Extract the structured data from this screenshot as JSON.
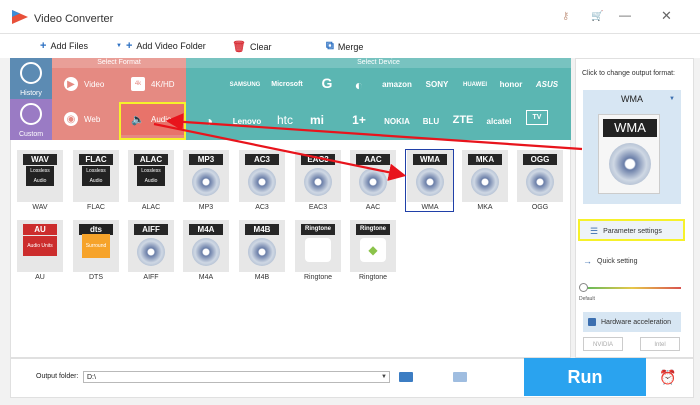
{
  "window": {
    "title": "Video Converter"
  },
  "toolbar": {
    "add_files": "Add Files",
    "add_video_folder": "Add Video Folder",
    "clear": "Clear",
    "merge": "Merge"
  },
  "sidebar": {
    "history": "History",
    "custom": "Custom"
  },
  "select_format": {
    "header": "Select Format",
    "items": [
      {
        "label": "Video"
      },
      {
        "label": "4K/HD"
      },
      {
        "label": "Web"
      },
      {
        "label": "Audio",
        "selected": true
      }
    ]
  },
  "select_device": {
    "header": "Select Device",
    "brands_row1": [
      "SAMSUNG",
      "Microsoft",
      "G",
      "amazon",
      "SONY",
      "HUAWEI",
      "honor",
      "ASUS"
    ],
    "brands_row2": [
      "Lenovo",
      "htc",
      "mi",
      "1+",
      "NOKIA",
      "BLU",
      "ZTE",
      "alcatel",
      "TV"
    ]
  },
  "formats": [
    {
      "tag": "WAV",
      "label": "WAV",
      "badge": "Lossless Audio"
    },
    {
      "tag": "FLAC",
      "label": "FLAC",
      "badge": "Lossless Audio"
    },
    {
      "tag": "ALAC",
      "label": "ALAC",
      "badge": "Lossless Audio"
    },
    {
      "tag": "MP3",
      "label": "MP3"
    },
    {
      "tag": "AC3",
      "label": "AC3"
    },
    {
      "tag": "EAC3",
      "label": "EAC3"
    },
    {
      "tag": "AAC",
      "label": "AAC"
    },
    {
      "tag": "WMA",
      "label": "WMA",
      "selected": true
    },
    {
      "tag": "MKA",
      "label": "MKA"
    },
    {
      "tag": "OGG",
      "label": "OGG"
    },
    {
      "tag": "AU",
      "label": "AU",
      "badge": "Audio Units"
    },
    {
      "tag": "dts",
      "label": "DTS",
      "badge": "Surround"
    },
    {
      "tag": "AIFF",
      "label": "AIFF"
    },
    {
      "tag": "M4A",
      "label": "M4A"
    },
    {
      "tag": "M4B",
      "label": "M4B"
    },
    {
      "tag": "Ringtone",
      "label": "Ringtone"
    },
    {
      "tag": "Ringtone",
      "label": "Ringtone"
    }
  ],
  "right_panel": {
    "hint": "Click to change output format:",
    "selected_format": "WMA",
    "parameter_settings": "Parameter settings",
    "quick_setting": "Quick setting",
    "slider_label": "Default",
    "slider_value": 0,
    "hardware_acceleration": "Hardware acceleration",
    "nvidia": "NVIDIA",
    "intel": "Intel"
  },
  "bottom": {
    "output_folder_label": "Output folder:",
    "output_folder_value": "D:\\",
    "run_label": "Run"
  },
  "colors": {
    "sidebar": "#5c8bb3",
    "format_band": "#e58a82",
    "device_band": "#5bb6b2",
    "run_button": "#2aa3ef",
    "highlight": "#f6f12b",
    "arrow": "#e8141c"
  }
}
